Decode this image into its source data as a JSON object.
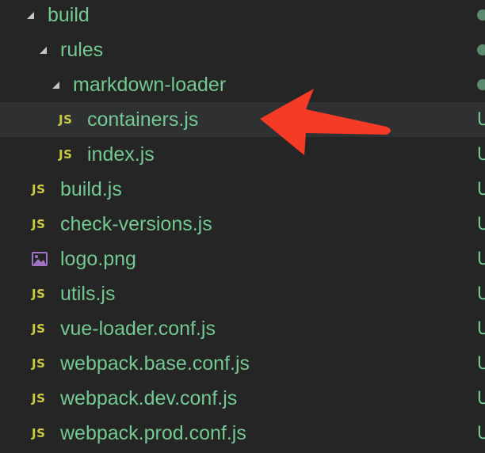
{
  "explorer": {
    "items": [
      {
        "label": "build",
        "type": "folder",
        "status_dot": true
      },
      {
        "label": "rules",
        "type": "folder",
        "status_dot": true
      },
      {
        "label": "markdown-loader",
        "type": "folder",
        "status_dot": true
      },
      {
        "label": "containers.js",
        "type": "js",
        "status": "U",
        "icon_text": "JS"
      },
      {
        "label": "index.js",
        "type": "js",
        "status": "U",
        "icon_text": "JS"
      },
      {
        "label": "build.js",
        "type": "js",
        "status": "U",
        "icon_text": "JS"
      },
      {
        "label": "check-versions.js",
        "type": "js",
        "status": "U",
        "icon_text": "JS"
      },
      {
        "label": "logo.png",
        "type": "image",
        "status": "U"
      },
      {
        "label": "utils.js",
        "type": "js",
        "status": "U",
        "icon_text": "JS"
      },
      {
        "label": "vue-loader.conf.js",
        "type": "js",
        "status": "U",
        "icon_text": "JS"
      },
      {
        "label": "webpack.base.conf.js",
        "type": "js",
        "status": "U",
        "icon_text": "JS"
      },
      {
        "label": "webpack.dev.conf.js",
        "type": "js",
        "status": "U",
        "icon_text": "JS"
      },
      {
        "label": "webpack.prod.conf.js",
        "type": "js",
        "status": "U",
        "icon_text": "JS"
      }
    ]
  },
  "colors": {
    "background": "#252526",
    "selected_row": "#2e3031",
    "label_untracked": "#73c991",
    "js_icon": "#cbcb41",
    "annotation_arrow": "#f53b26"
  }
}
